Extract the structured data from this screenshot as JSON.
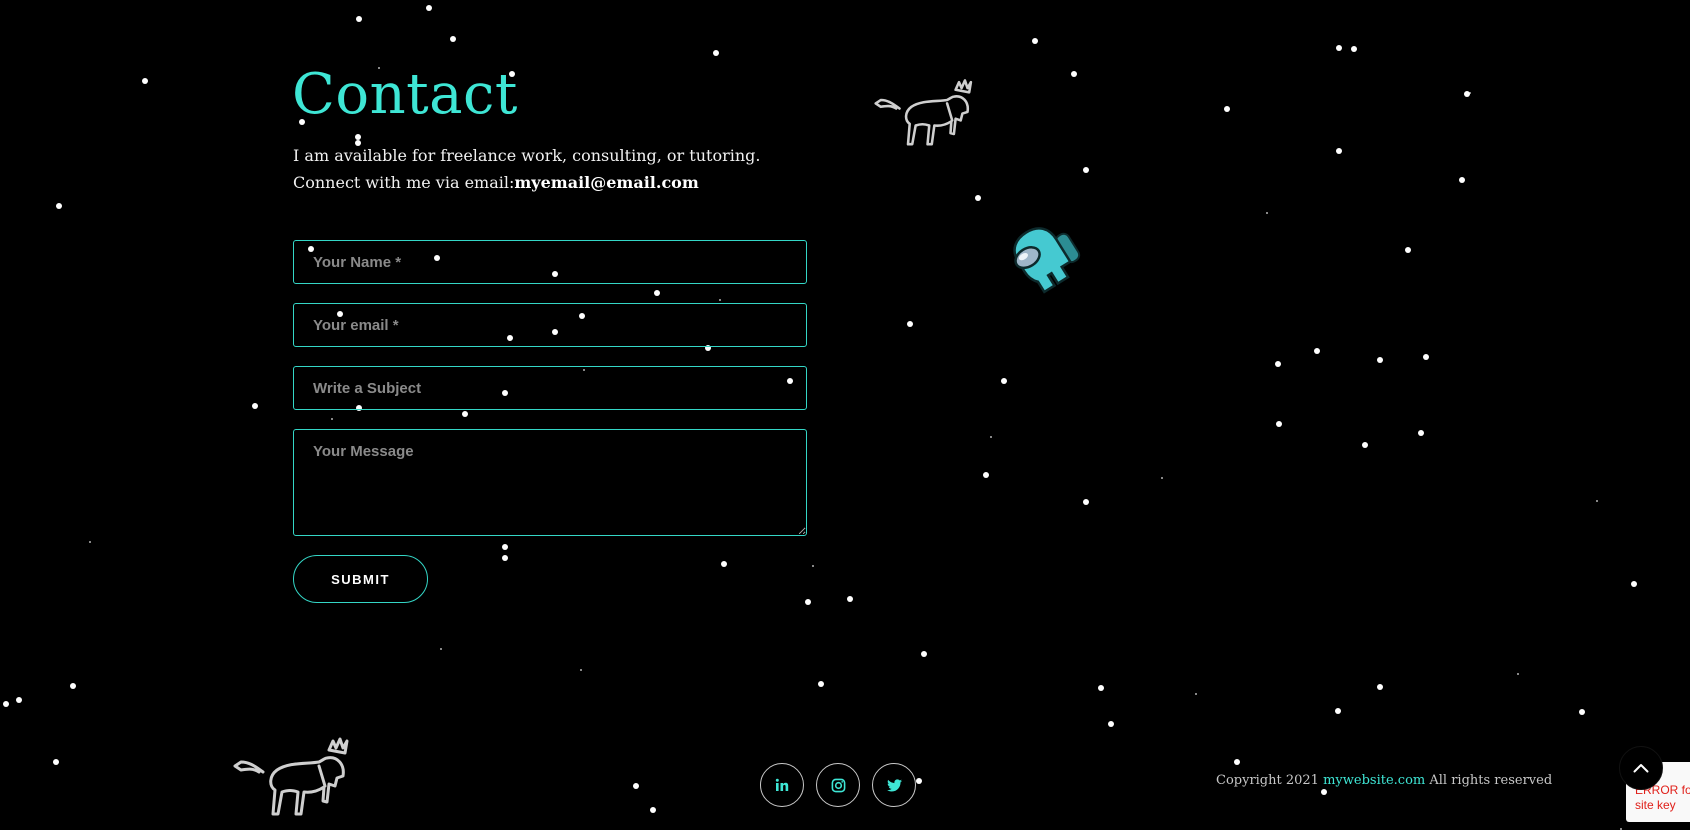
{
  "contact": {
    "heading": "Contact",
    "intro_line1": "I am available for freelance work, consulting, or tutoring.",
    "intro_line2_prefix": "Connect with me via email:",
    "email": "myemail@email.com"
  },
  "form": {
    "name_placeholder": "Your Name *",
    "email_placeholder": "Your email *",
    "subject_placeholder": "Write a Subject",
    "message_placeholder": "Your Message",
    "submit_label": "SUBMIT"
  },
  "footer": {
    "copyright_prefix": "Copyright 2021",
    "site_link": "mywebsite.com",
    "copyright_suffix": "All rights reserved"
  },
  "recaptcha": {
    "error_line1": "ERROR fo",
    "error_line2": "site key"
  },
  "icons": {
    "lion_logo": "lion-logo-icon",
    "astronaut": "astronaut-icon",
    "linkedin": "linkedin-icon",
    "instagram": "instagram-icon",
    "twitter": "twitter-icon",
    "back_to_top": "chevron-up-icon"
  },
  "colors": {
    "accent": "#3ee6d5",
    "background": "#000000",
    "text": "#ffffff",
    "placeholder": "#8a8a8a",
    "error": "#e0201a"
  }
}
